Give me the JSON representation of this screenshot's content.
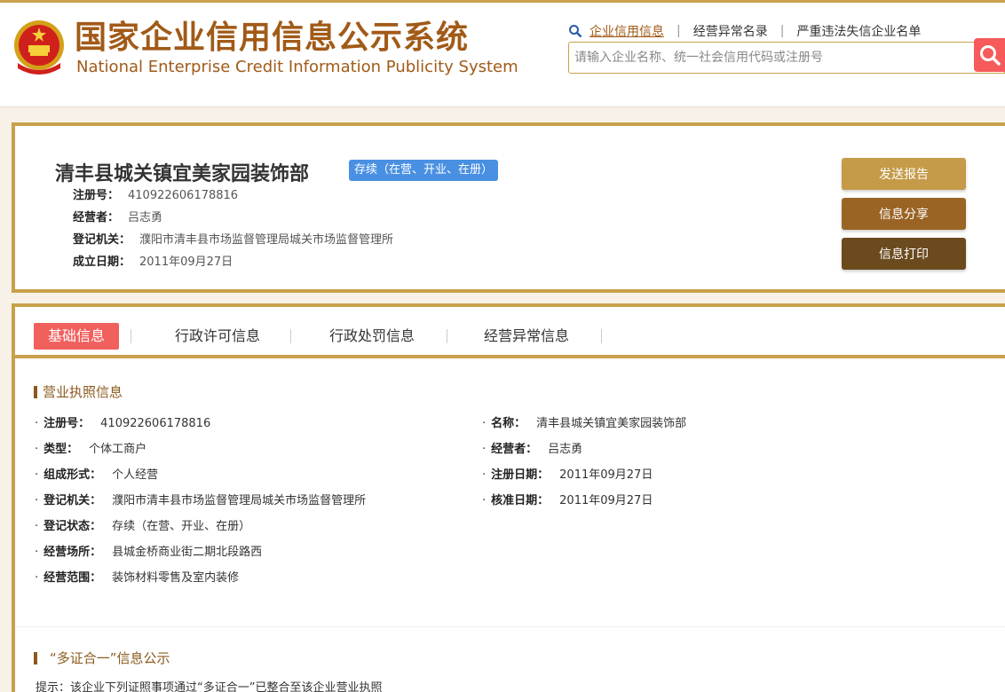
{
  "header": {
    "title_cn": "国家企业信用信息公示系统",
    "title_en": "National Enterprise Credit Information Publicity System",
    "nav": [
      "企业信用信息",
      "经营异常名录",
      "严重违法失信企业名单"
    ],
    "search_placeholder": "请输入企业名称、统一社会信用代码或注册号"
  },
  "company": {
    "name": "清丰县城关镇宜美家园装饰部",
    "status": "存续（在营、开业、在册）",
    "fields": [
      {
        "label": "注册号：",
        "value": "410922606178816"
      },
      {
        "label": "经营者：",
        "value": "吕志勇"
      },
      {
        "label": "登记机关：",
        "value": "濮阳市清丰县市场监督管理局城关市场监督管理所"
      },
      {
        "label": "成立日期：",
        "value": "2011年09月27日"
      }
    ],
    "buttons": {
      "send": "发送报告",
      "share": "信息分享",
      "print": "信息打印"
    }
  },
  "tabs": [
    "基础信息",
    "行政许可信息",
    "行政处罚信息",
    "经营异常信息"
  ],
  "license": {
    "title": "营业执照信息",
    "left": [
      {
        "label": "注册号：",
        "value": "410922606178816"
      },
      {
        "label": "类型：",
        "value": "个体工商户"
      },
      {
        "label": "组成形式：",
        "value": "个人经营"
      },
      {
        "label": "登记机关：",
        "value": "濮阳市清丰县市场监督管理局城关市场监督管理所"
      },
      {
        "label": "登记状态：",
        "value": "存续（在营、开业、在册）"
      },
      {
        "label": "经营场所：",
        "value": "县城金桥商业街二期北段路西"
      },
      {
        "label": "经营范围：",
        "value": "装饰材料零售及室内装修"
      }
    ],
    "right": [
      {
        "label": "名称：",
        "value": "清丰县城关镇宜美家园装饰部"
      },
      {
        "label": "经营者：",
        "value": "吕志勇"
      },
      {
        "label": "注册日期：",
        "value": "2011年09月27日"
      },
      {
        "label": "核准日期：",
        "value": "2011年09月27日"
      }
    ]
  },
  "multi_cert": {
    "title": "“多证合一”信息公示",
    "note": "提示：该企业下列证照事项通过“多证合一”已整合至该企业营业执照"
  }
}
